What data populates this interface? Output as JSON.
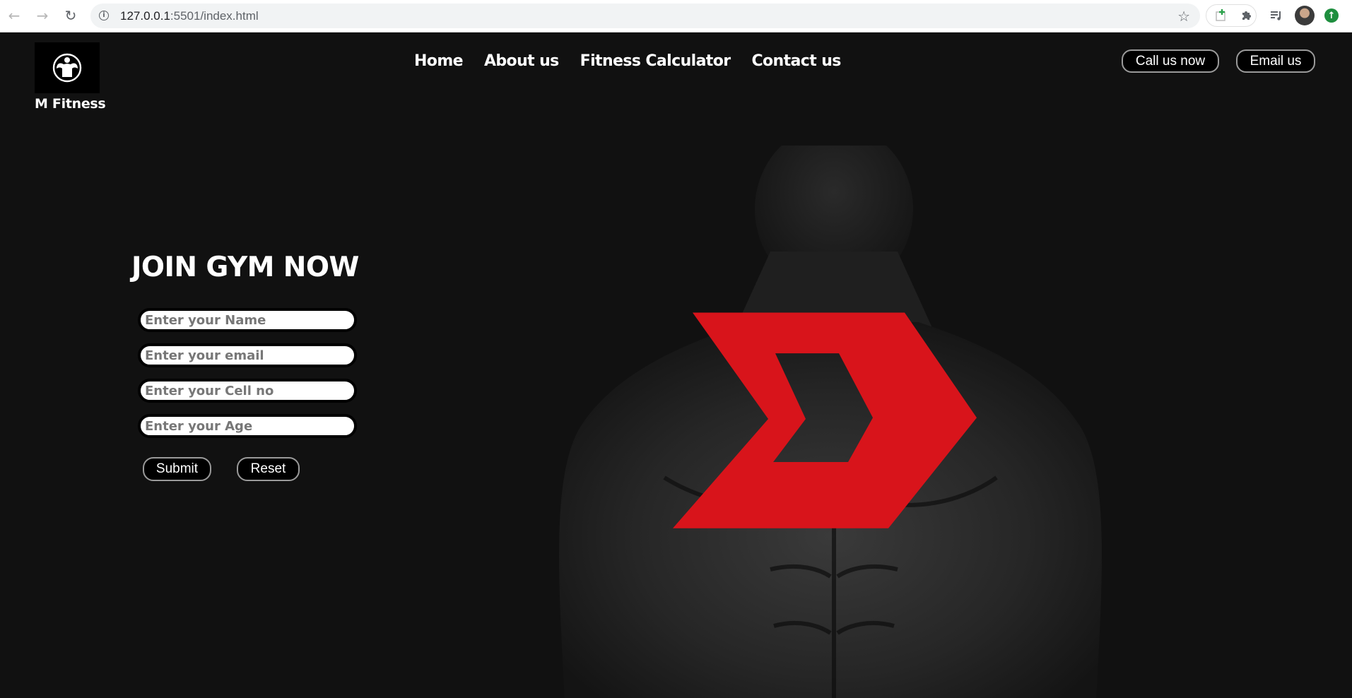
{
  "browser": {
    "url_host": "127.0.0.1",
    "url_rest": ":5501/index.html",
    "icons": [
      "back-arrow-icon",
      "forward-arrow-icon",
      "reload-icon",
      "info-icon",
      "star-icon",
      "extension-add-icon",
      "puzzle-icon",
      "reading-list-icon",
      "profile-avatar",
      "update-icon"
    ]
  },
  "brand": {
    "name": "M Fitness",
    "logo_icon": "bodybuilder-icon"
  },
  "nav": {
    "items": [
      "Home",
      "About us",
      "Fitness Calculator",
      "Contact us"
    ]
  },
  "header_actions": {
    "call_label": "Call us now",
    "email_label": "Email us"
  },
  "join_form": {
    "title": "JOIN GYM NOW",
    "name_placeholder": "Enter your Name",
    "email_placeholder": "Enter your email",
    "cell_placeholder": "Enter your Cell no",
    "age_placeholder": "Enter your Age",
    "submit_label": "Submit",
    "reset_label": "Reset"
  },
  "colors": {
    "background": "#111111",
    "accent_red": "#d8141b",
    "text": "#ffffff"
  }
}
